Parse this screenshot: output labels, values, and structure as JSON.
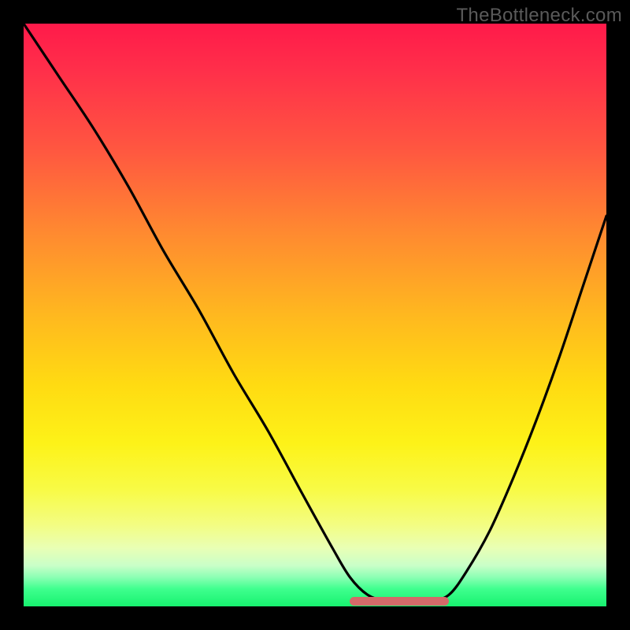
{
  "watermark": "TheBottleneck.com",
  "colors": {
    "background": "#000000",
    "line": "#000000",
    "flat_region": "#d46a69",
    "watermark": "#5a5a5a"
  },
  "chart_data": {
    "type": "line",
    "title": "",
    "xlabel": "",
    "ylabel": "",
    "xlim": [
      0,
      100
    ],
    "ylim": [
      0,
      100
    ],
    "grid": false,
    "legend": false,
    "series": [
      {
        "name": "curve",
        "x": [
          0,
          6,
          12,
          18,
          24,
          30,
          36,
          42,
          48,
          53,
          56,
          59,
          62,
          66,
          70,
          73,
          76,
          80,
          84,
          88,
          92,
          96,
          100
        ],
        "y": [
          100,
          91,
          82,
          72,
          61,
          51,
          40,
          30,
          19,
          10,
          5,
          2,
          1,
          1,
          1,
          2,
          6,
          13,
          22,
          32,
          43,
          55,
          67
        ],
        "note": "y is bottleneck percentage; curve dips to ~0 between x≈59 and x≈73 (optimal zone)"
      }
    ],
    "flat_optimal_region": {
      "x_start": 56,
      "x_end": 73,
      "y": 1
    }
  }
}
